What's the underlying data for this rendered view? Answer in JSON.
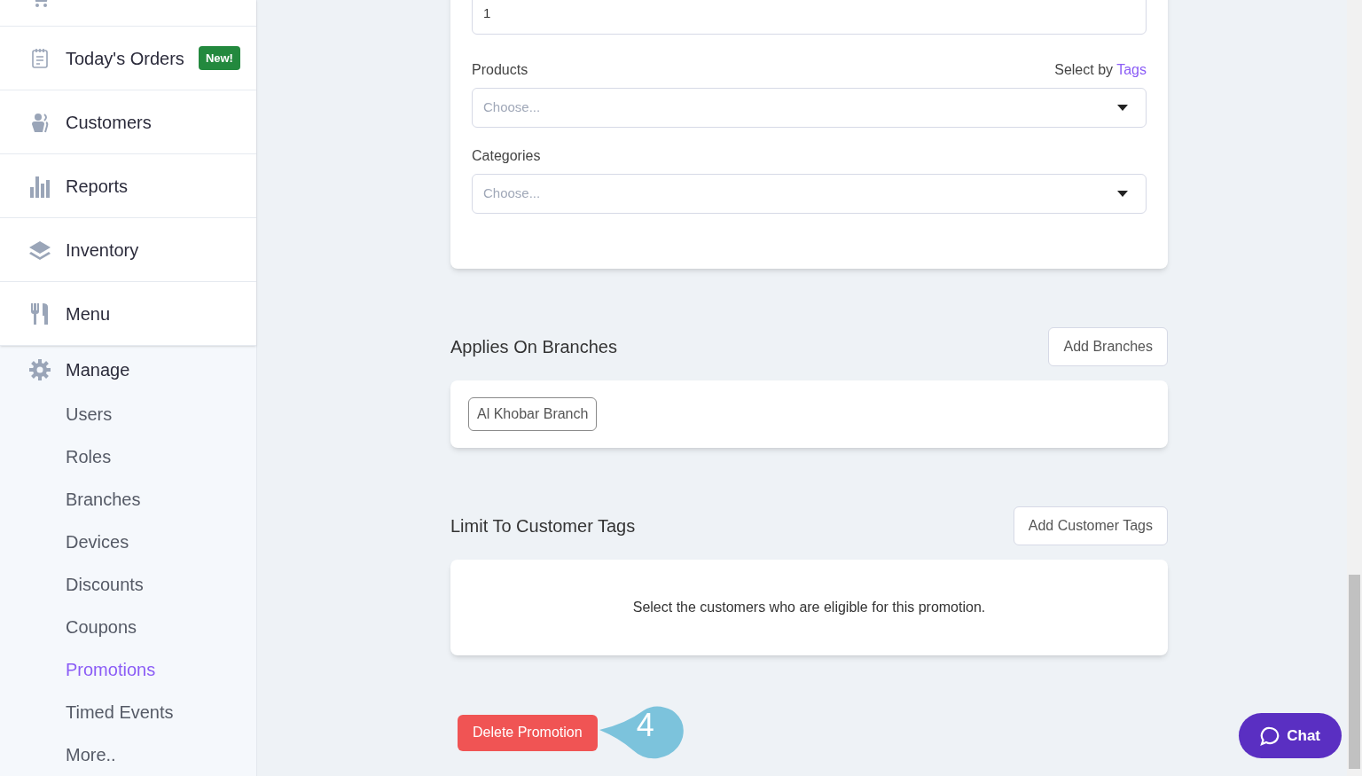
{
  "sidebar": {
    "items": [
      {
        "label": "Today's Orders",
        "badge": "New!"
      },
      {
        "label": "Customers"
      },
      {
        "label": "Reports"
      },
      {
        "label": "Inventory"
      },
      {
        "label": "Menu"
      }
    ],
    "section": {
      "label": "Manage",
      "children": [
        {
          "label": "Users",
          "selected": false
        },
        {
          "label": "Roles",
          "selected": false
        },
        {
          "label": "Branches",
          "selected": false
        },
        {
          "label": "Devices",
          "selected": false
        },
        {
          "label": "Discounts",
          "selected": false
        },
        {
          "label": "Coupons",
          "selected": false
        },
        {
          "label": "Promotions",
          "selected": true
        },
        {
          "label": "Timed Events",
          "selected": false
        },
        {
          "label": "More..",
          "selected": false
        }
      ]
    }
  },
  "form": {
    "top_field": {
      "value": "1"
    },
    "products": {
      "label": "Products",
      "link_prefix": "Select by",
      "link": "Tags",
      "placeholder": "Choose..."
    },
    "categories": {
      "label": "Categories",
      "placeholder": "Choose..."
    }
  },
  "branches": {
    "title": "Applies On Branches",
    "button": "Add Branches",
    "tags": [
      "Al Khobar Branch"
    ]
  },
  "customer_tags": {
    "title": "Limit To Customer Tags",
    "button": "Add Customer Tags",
    "empty_text": "Select the customers who are eligible for this promotion."
  },
  "delete_button": "Delete Promotion",
  "step_marker": "4",
  "chat_button": "Chat"
}
